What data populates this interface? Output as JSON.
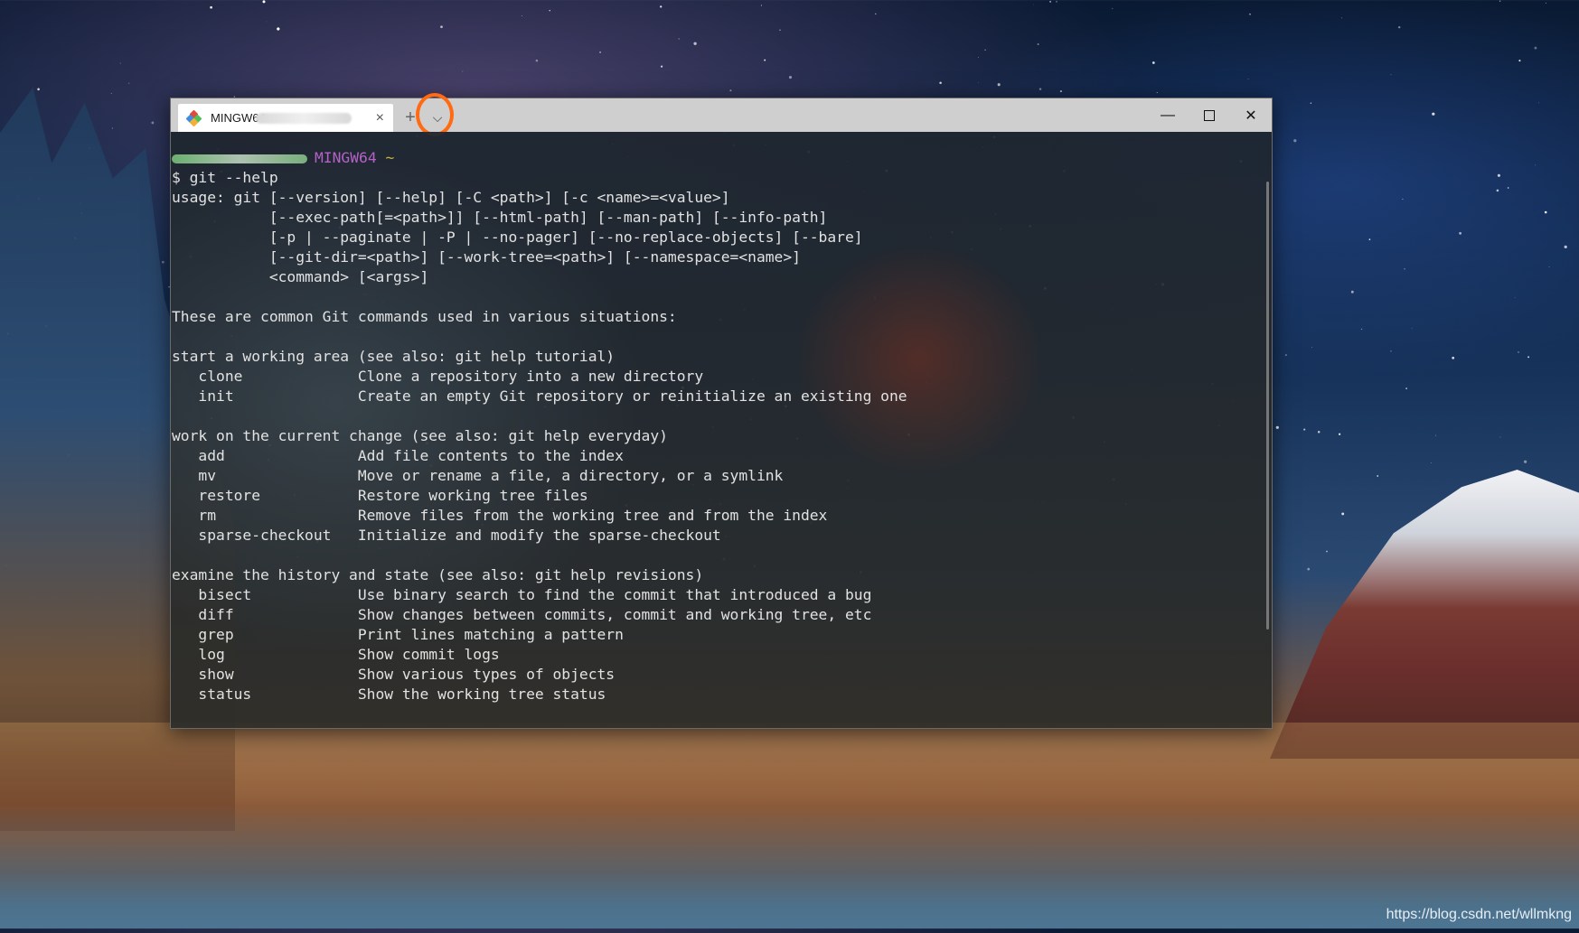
{
  "window": {
    "tab_title": "MINGW64:",
    "tab_close": "×",
    "new_tab": "+",
    "dropdown": "⌵",
    "minimize": "—",
    "close": "✕"
  },
  "terminal": {
    "prompt_system": "MINGW64",
    "prompt_dir": "~",
    "lines": [
      "$ git --help",
      "usage: git [--version] [--help] [-C <path>] [-c <name>=<value>]",
      "           [--exec-path[=<path>]] [--html-path] [--man-path] [--info-path]",
      "           [-p | --paginate | -P | --no-pager] [--no-replace-objects] [--bare]",
      "           [--git-dir=<path>] [--work-tree=<path>] [--namespace=<name>]",
      "           <command> [<args>]",
      "",
      "These are common Git commands used in various situations:",
      "",
      "start a working area (see also: git help tutorial)",
      "   clone             Clone a repository into a new directory",
      "   init              Create an empty Git repository or reinitialize an existing one",
      "",
      "work on the current change (see also: git help everyday)",
      "   add               Add file contents to the index",
      "   mv                Move or rename a file, a directory, or a symlink",
      "   restore           Restore working tree files",
      "   rm                Remove files from the working tree and from the index",
      "   sparse-checkout   Initialize and modify the sparse-checkout",
      "",
      "examine the history and state (see also: git help revisions)",
      "   bisect            Use binary search to find the commit that introduced a bug",
      "   diff              Show changes between commits, commit and working tree, etc",
      "   grep              Print lines matching a pattern",
      "   log               Show commit logs",
      "   show              Show various types of objects",
      "   status            Show the working tree status"
    ]
  },
  "watermark": "https://blog.csdn.net/wllmkng",
  "colors": {
    "highlight_ring": "#ff6a13",
    "prompt_system": "#b462c6",
    "prompt_dir": "#c9b541"
  }
}
